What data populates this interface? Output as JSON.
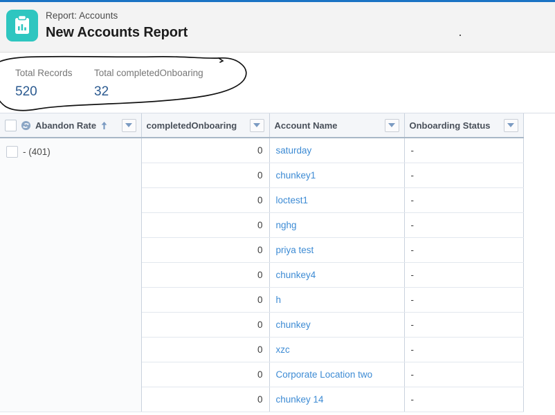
{
  "window": {
    "accent_color": "#1a73c4",
    "brand_color": "#2ec6c0",
    "link_color": "#3d8bd4"
  },
  "header": {
    "icon": "report-clipboard-icon",
    "eyebrow": "Report: Accounts",
    "title": "New Accounts Report"
  },
  "summary": {
    "items": [
      {
        "label": "Total Records",
        "value": "520"
      },
      {
        "label": "Total completedOnboaring",
        "value": "32"
      }
    ],
    "annotation": "hand-drawn-ellipse"
  },
  "table": {
    "columns": [
      {
        "label": "Abandon Rate",
        "has_checkbox": true,
        "icon": "sync-icon",
        "sort": "asc",
        "sort_icon": "arrow-up-icon",
        "menu_icon": "chevron-down-icon",
        "align": "left"
      },
      {
        "label": "completedOnboaring",
        "has_checkbox": false,
        "menu_icon": "chevron-down-icon",
        "align": "right"
      },
      {
        "label": "Account Name",
        "has_checkbox": false,
        "menu_icon": "chevron-down-icon",
        "align": "left"
      },
      {
        "label": "Onboarding Status",
        "has_checkbox": false,
        "menu_icon": "chevron-down-icon",
        "align": "left"
      }
    ],
    "group": {
      "label": "- (401)",
      "has_checkbox": true
    },
    "rows": [
      {
        "completed": "0",
        "account": "saturday",
        "status": "-"
      },
      {
        "completed": "0",
        "account": "chunkey1",
        "status": "-"
      },
      {
        "completed": "0",
        "account": "loctest1",
        "status": "-"
      },
      {
        "completed": "0",
        "account": "nghg",
        "status": "-"
      },
      {
        "completed": "0",
        "account": "priya test",
        "status": "-"
      },
      {
        "completed": "0",
        "account": "chunkey4",
        "status": "-"
      },
      {
        "completed": "0",
        "account": "h",
        "status": "-"
      },
      {
        "completed": "0",
        "account": "chunkey",
        "status": "-"
      },
      {
        "completed": "0",
        "account": "xzc",
        "status": "-"
      },
      {
        "completed": "0",
        "account": "Corporate Location two",
        "status": "-"
      },
      {
        "completed": "0",
        "account": "chunkey 14",
        "status": "-"
      }
    ]
  }
}
